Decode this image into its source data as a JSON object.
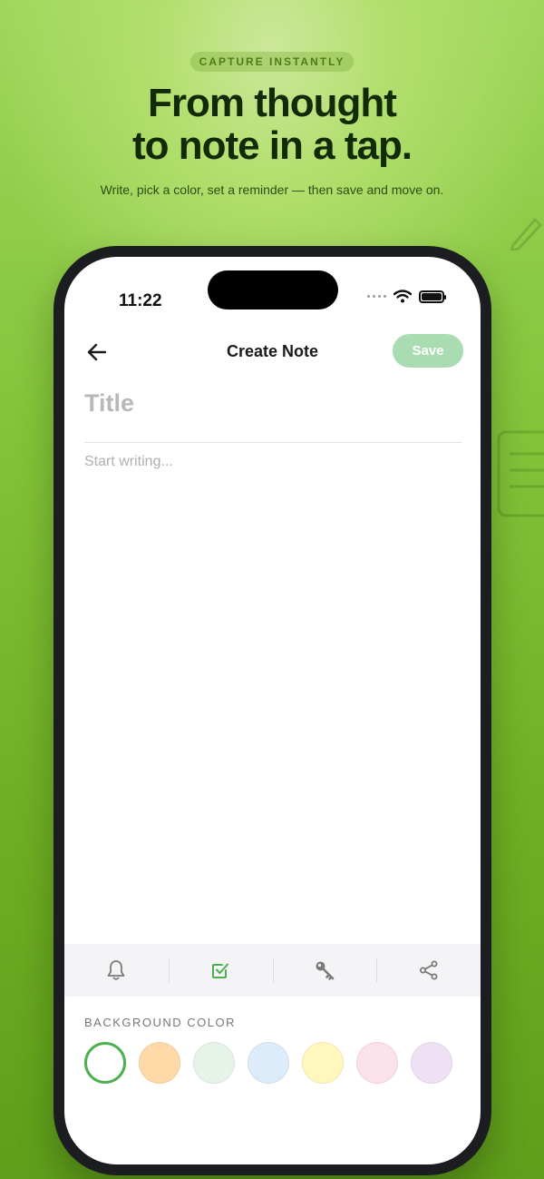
{
  "marketing": {
    "badge": "CAPTURE INSTANTLY",
    "headline_line1": "From thought",
    "headline_line2": "to note in a tap.",
    "subline": "Write, pick a color, set a reminder — then save and move on."
  },
  "status_bar": {
    "time": "11:22",
    "icons": [
      "signal-dots-icon",
      "wifi-icon",
      "battery-icon"
    ]
  },
  "nav": {
    "back_icon": "arrow-left-icon",
    "title": "Create Note",
    "save_label": "Save"
  },
  "editor": {
    "title_placeholder": "Title",
    "title_value": "",
    "body_placeholder": "Start writing...",
    "body_value": ""
  },
  "toolbar": {
    "tools": [
      {
        "name": "reminder",
        "icon": "bell-icon"
      },
      {
        "name": "checklist",
        "icon": "checkbox-icon",
        "active": true
      },
      {
        "name": "lock",
        "icon": "key-icon"
      },
      {
        "name": "share",
        "icon": "share-icon"
      }
    ]
  },
  "background_color": {
    "label": "BACKGROUND COLOR",
    "options": [
      {
        "name": "white",
        "color": "#ffffff",
        "selected": true
      },
      {
        "name": "orange",
        "color": "#ffd9a8",
        "selected": false
      },
      {
        "name": "green",
        "color": "#e6f3e8",
        "selected": false
      },
      {
        "name": "blue",
        "color": "#dcecfb",
        "selected": false
      },
      {
        "name": "yellow",
        "color": "#fff7bd",
        "selected": false
      },
      {
        "name": "pink",
        "color": "#fbe1e9",
        "selected": false
      },
      {
        "name": "purple",
        "color": "#efe1f4",
        "selected": false
      }
    ]
  },
  "colors": {
    "accent": "#4caf50",
    "save_disabled": "#a9dcb0",
    "toolbar_bg": "#f4f4f7"
  }
}
